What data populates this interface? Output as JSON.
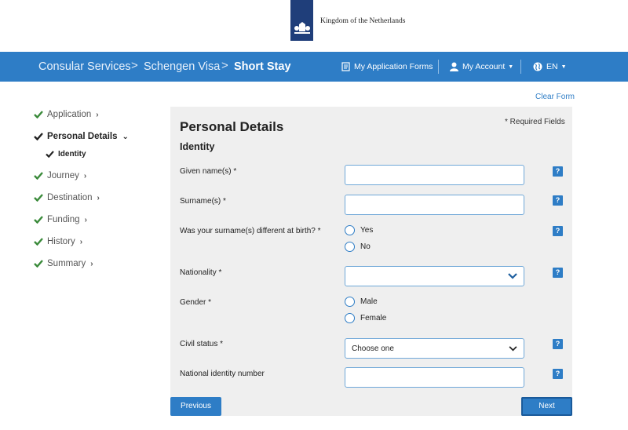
{
  "header": {
    "org_name": "Kingdom of the Netherlands"
  },
  "nav": {
    "breadcrumbs": [
      "Consular Services",
      "Schengen Visa",
      "Short Stay"
    ],
    "separator": ">",
    "forms_label": "My Application Forms",
    "account_label": "My Account",
    "language_label": "EN",
    "icons": [
      "document-icon",
      "user-icon",
      "globe-icon"
    ]
  },
  "sidebar": {
    "items": [
      {
        "label": "Application",
        "completed": true,
        "expanded": false
      },
      {
        "label": "Personal Details",
        "completed": true,
        "expanded": true
      },
      {
        "label": "Journey",
        "completed": true,
        "expanded": false
      },
      {
        "label": "Destination",
        "completed": true,
        "expanded": false
      },
      {
        "label": "Funding",
        "completed": true,
        "expanded": false
      },
      {
        "label": "History",
        "completed": true,
        "expanded": false
      },
      {
        "label": "Summary",
        "completed": true,
        "expanded": false
      }
    ],
    "sub_item": {
      "label": "Identity",
      "completed": true
    }
  },
  "form": {
    "clear_label": "Clear Form",
    "title": "Personal Details",
    "required_note": "* Required Fields",
    "section": "Identity",
    "fields": {
      "given_names": {
        "label": "Given name(s) *",
        "value": ""
      },
      "surname": {
        "label": "Surname(s) *",
        "value": ""
      },
      "surname_birth": {
        "label": "Was your surname(s) different at birth? *",
        "options": [
          "Yes",
          "No"
        ]
      },
      "nationality": {
        "label": "Nationality *",
        "value": ""
      },
      "gender": {
        "label": "Gender *",
        "options": [
          "Male",
          "Female"
        ]
      },
      "civil_status": {
        "label": "Civil status *",
        "value": "Choose one"
      },
      "national_id": {
        "label": "National identity number",
        "value": ""
      }
    },
    "help_label": "?",
    "prev_label": "Previous",
    "next_label": "Next"
  },
  "colors": {
    "accent": "#2e7dc6",
    "check": "#3a8a3a",
    "panel": "#efefef",
    "logo_bg": "#1f3e7a"
  }
}
